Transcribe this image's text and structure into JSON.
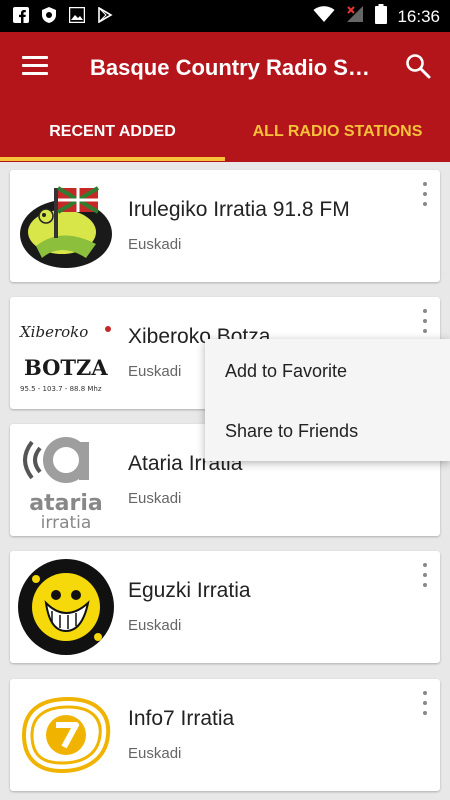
{
  "status": {
    "time": "16:36",
    "icons": [
      "facebook-icon",
      "shield-icon",
      "image-icon",
      "play-store-icon",
      "wifi-icon",
      "no-signal-icon",
      "battery-icon"
    ]
  },
  "appbar": {
    "title": "Basque Country Radio S…",
    "colors": {
      "primary": "#b3151b",
      "accent": "#f7c23a"
    }
  },
  "tabs": [
    {
      "label": "RECENT ADDED",
      "selected": true
    },
    {
      "label": "ALL RADIO STATIONS",
      "selected": false
    }
  ],
  "stations": [
    {
      "name": "Irulegiko Irratia 91.8 FM",
      "region": "Euskadi",
      "logo": "irulegi-logo"
    },
    {
      "name": "Xiberoko Botza",
      "region": "Euskadi",
      "logo": "xiberoko-botza-logo",
      "logo_text": {
        "top": "Xiberoko",
        "main": "BOTZA",
        "freqs": "95.5 - 103.7 - 88.8 Mhz"
      }
    },
    {
      "name": "Ataria Irratia",
      "region": "Euskadi",
      "logo": "ataria-logo",
      "logo_text": {
        "top": "ataria",
        "bottom": "irratia"
      }
    },
    {
      "name": "Eguzki Irratia",
      "region": "Euskadi",
      "logo": "eguzki-logo"
    },
    {
      "name": "Info7 Irratia",
      "region": "Euskadi",
      "logo": "info7-logo"
    }
  ],
  "menu": {
    "items": [
      "Add to Favorite",
      "Share to Friends"
    ]
  }
}
